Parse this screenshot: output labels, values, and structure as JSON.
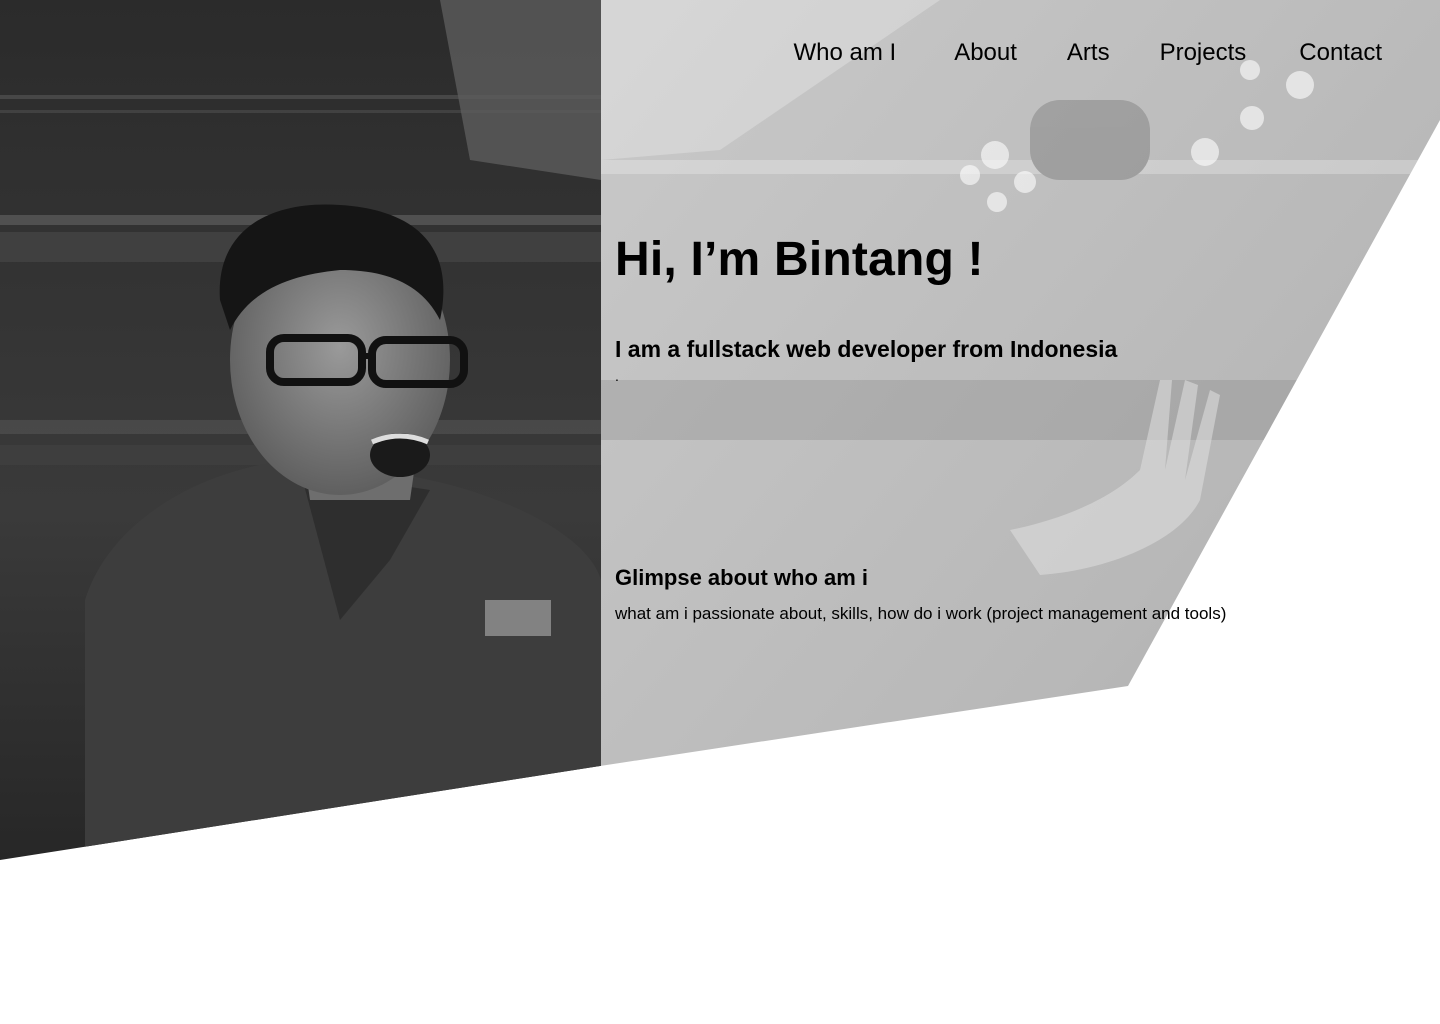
{
  "nav": {
    "items": [
      {
        "label": "Who am I"
      },
      {
        "label": "About"
      },
      {
        "label": "Arts"
      },
      {
        "label": "Projects"
      },
      {
        "label": "Contact"
      }
    ]
  },
  "hero": {
    "title": "Hi, I’m Bintang !",
    "subtitle": "I am a fullstack web developer from Indonesia",
    "trailing_mark": "."
  },
  "glimpse": {
    "title": "Glimpse about who am i",
    "description": "what am i passionate about, skills, how do i work (project management and tools)"
  },
  "colors": {
    "background": "#ffffff",
    "photo_dark": "#2a2a2a",
    "photo_overlay": "#bdbdbd",
    "text": "#000000"
  },
  "icons": [
    "hero-portrait-photo"
  ]
}
